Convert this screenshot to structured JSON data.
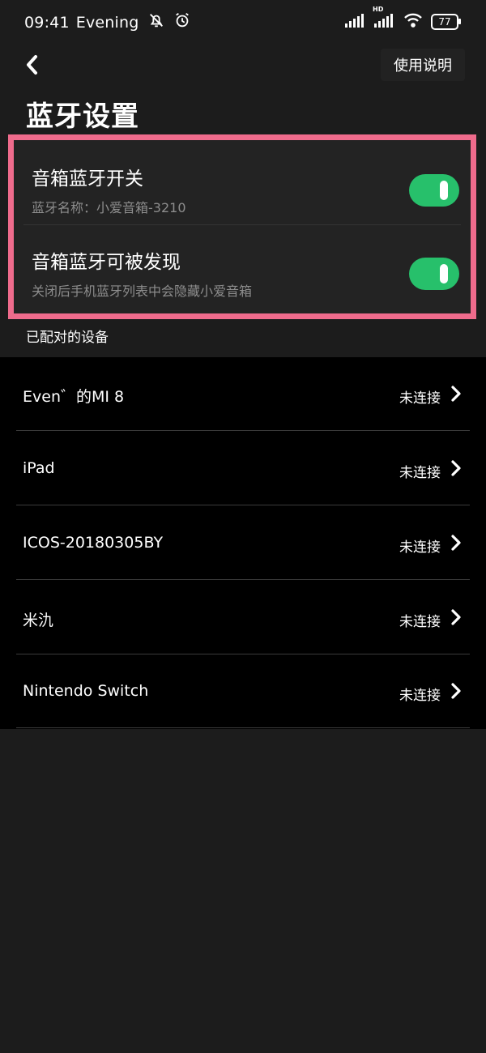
{
  "status_bar": {
    "time": "09:41",
    "label": "Evening",
    "network_badge": "HD",
    "battery": "77"
  },
  "header": {
    "help_label": "使用说明"
  },
  "page": {
    "title": "蓝牙设置"
  },
  "settings": [
    {
      "title": "音箱蓝牙开关",
      "subtitle": "蓝牙名称：小爱音箱-3210",
      "enabled": true
    },
    {
      "title": "音箱蓝牙可被发现",
      "subtitle": "关闭后手机蓝牙列表中会隐藏小爱音箱",
      "enabled": true
    }
  ],
  "paired_section_label": "已配对的设备",
  "devices": [
    {
      "name": "Even゛的MI 8",
      "status": "未连接"
    },
    {
      "name": "iPad",
      "status": "未连接"
    },
    {
      "name": "ICOS-20180305BY",
      "status": "未连接"
    },
    {
      "name": "米氿",
      "status": "未连接"
    },
    {
      "name": "Nintendo Switch",
      "status": "未连接"
    }
  ],
  "colors": {
    "background": "#1c1c1c",
    "toggle_on": "#27c06b",
    "highlight_border": "#ef6b8c",
    "list_bg": "#000000"
  }
}
